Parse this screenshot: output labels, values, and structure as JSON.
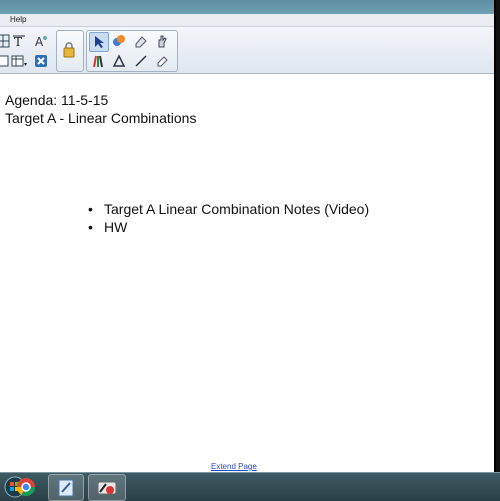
{
  "window": {
    "menu": {
      "help_label": "Help"
    }
  },
  "toolbar": {
    "icons": [
      "grid-icon",
      "text-icon",
      "font-icon",
      "lock-icon",
      "select-arrow-icon",
      "fill-icon",
      "eraser-icon",
      "hand-icon",
      "table-icon",
      "pens-icon",
      "shape-icon",
      "line-icon",
      "eraser2-icon"
    ]
  },
  "page": {
    "agenda_line1": "Agenda: 11-5-15",
    "agenda_line2": "Target A - Linear Combinations",
    "bullets": [
      "Target A Linear Combination Notes (Video)",
      "HW"
    ],
    "extend_link": "Extend Page"
  },
  "taskbar": {
    "items": [
      "start-button",
      "chrome-icon",
      "notebook-app-icon",
      "smart-board-tools-icon"
    ]
  },
  "colors": {
    "taskbar": "#2f4a52",
    "toolbar": "#e6ecf3",
    "link": "#2a4bd4"
  }
}
